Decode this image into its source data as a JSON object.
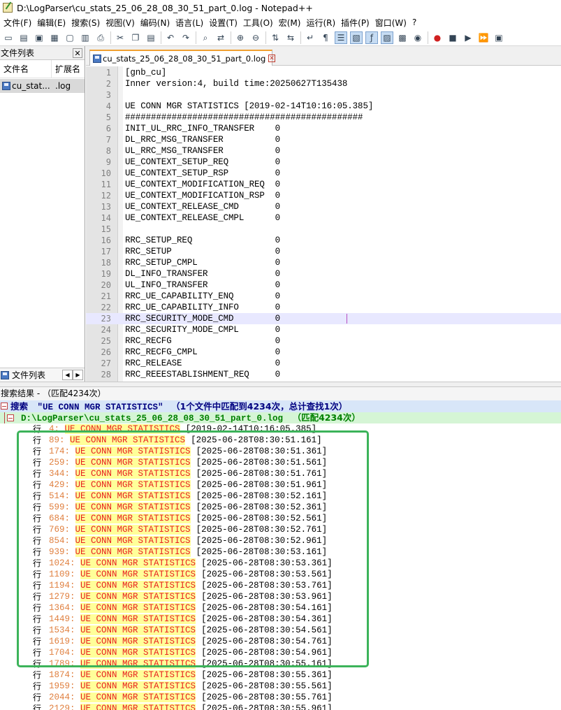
{
  "window": {
    "title": "D:\\LogParser\\cu_stats_25_06_28_08_30_51_part_0.log - Notepad++"
  },
  "menu": [
    "文件(F)",
    "编辑(E)",
    "搜索(S)",
    "视图(V)",
    "编码(N)",
    "语言(L)",
    "设置(T)",
    "工具(O)",
    "宏(M)",
    "运行(R)",
    "插件(P)",
    "窗口(W)",
    "?"
  ],
  "toolbar": {
    "groups": [
      [
        "new-file-icon",
        "open-file-icon",
        "save-icon",
        "save-all-icon",
        "close-icon",
        "close-all-icon",
        "print-icon"
      ],
      [
        "cut-icon",
        "copy-icon",
        "paste-icon"
      ],
      [
        "undo-icon",
        "redo-icon"
      ],
      [
        "find-icon",
        "replace-icon"
      ],
      [
        "zoom-in-icon",
        "zoom-out-icon"
      ],
      [
        "sync-vertical-icon",
        "sync-horizontal-icon"
      ],
      [
        "word-wrap-icon",
        "show-all-chars-icon",
        "indent-guide-icon",
        "doc-map-icon",
        "function-list-icon",
        "folder-workspace-icon",
        "monitoring-icon",
        "eye-icon"
      ],
      [
        "record-macro-icon",
        "stop-macro-icon",
        "play-macro-icon",
        "play-multiple-icon",
        "save-macro-icon"
      ]
    ],
    "glyphs": {
      "new-file-icon": "▭",
      "open-file-icon": "▤",
      "save-icon": "▣",
      "save-all-icon": "▦",
      "close-icon": "▢",
      "close-all-icon": "▥",
      "print-icon": "⎙",
      "cut-icon": "✂",
      "copy-icon": "❐",
      "paste-icon": "▤",
      "undo-icon": "↶",
      "redo-icon": "↷",
      "find-icon": "⌕",
      "replace-icon": "⇄",
      "zoom-in-icon": "⊕",
      "zoom-out-icon": "⊖",
      "sync-vertical-icon": "⇅",
      "sync-horizontal-icon": "⇆",
      "word-wrap-icon": "↵",
      "show-all-chars-icon": "¶",
      "indent-guide-icon": "☰",
      "doc-map-icon": "▧",
      "function-list-icon": "ƒ",
      "folder-workspace-icon": "▨",
      "monitoring-icon": "▩",
      "eye-icon": "◉",
      "record-macro-icon": "●",
      "stop-macro-icon": "■",
      "play-macro-icon": "▶",
      "play-multiple-icon": "⏩",
      "save-macro-icon": "▣"
    },
    "active": [
      "indent-guide-icon",
      "function-list-icon",
      "doc-map-icon",
      "folder-workspace-icon"
    ],
    "accent_record": "#d02020"
  },
  "file_panel": {
    "title": "文件列表",
    "col_name": "文件名",
    "col_ext": "扩展名",
    "files": [
      {
        "name": "cu_stat...",
        "ext": ".log"
      }
    ],
    "tab_label": "文件列表"
  },
  "editor": {
    "tab_label": "cu_stats_25_06_28_08_30_51_part_0.log",
    "current_line": 23,
    "lines": [
      {
        "n": "1",
        "text": "[gnb_cu]"
      },
      {
        "n": "2",
        "text": "Inner version:4, build time:20250627T135438"
      },
      {
        "n": "3",
        "text": ""
      },
      {
        "n": "4",
        "text": "UE CONN MGR STATISTICS [2019-02-14T10:16:05.385]"
      },
      {
        "n": "5",
        "text": "##############################################"
      },
      {
        "n": "6",
        "text": "INIT_UL_RRC_INFO_TRANSFER    0"
      },
      {
        "n": "7",
        "text": "DL_RRC_MSG_TRANSFER          0"
      },
      {
        "n": "8",
        "text": "UL_RRC_MSG_TRANSFER          0"
      },
      {
        "n": "9",
        "text": "UE_CONTEXT_SETUP_REQ         0"
      },
      {
        "n": "10",
        "text": "UE_CONTEXT_SETUP_RSP         0"
      },
      {
        "n": "11",
        "text": "UE_CONTEXT_MODIFICATION_REQ  0"
      },
      {
        "n": "12",
        "text": "UE_CONTEXT_MODIFICATION_RSP  0"
      },
      {
        "n": "13",
        "text": "UE_CONTEXT_RELEASE_CMD       0"
      },
      {
        "n": "14",
        "text": "UE_CONTEXT_RELEASE_CMPL      0"
      },
      {
        "n": "15",
        "text": ""
      },
      {
        "n": "16",
        "text": "RRC_SETUP_REQ                0"
      },
      {
        "n": "17",
        "text": "RRC_SETUP                    0"
      },
      {
        "n": "18",
        "text": "RRC_SETUP_CMPL               0"
      },
      {
        "n": "19",
        "text": "DL_INFO_TRANSFER             0"
      },
      {
        "n": "20",
        "text": "UL_INFO_TRANSFER             0"
      },
      {
        "n": "21",
        "text": "RRC_UE_CAPABILITY_ENQ        0"
      },
      {
        "n": "22",
        "text": "RRC_UE_CAPABILITY_INFO       0"
      },
      {
        "n": "23",
        "text": "RRC_SECURITY_MODE_CMD        0"
      },
      {
        "n": "24",
        "text": "RRC_SECURITY_MODE_CMPL       0"
      },
      {
        "n": "25",
        "text": "RRC_RECFG                    0"
      },
      {
        "n": "26",
        "text": "RRC_RECFG_CMPL               0"
      },
      {
        "n": "27",
        "text": "RRC_RELEASE                  0"
      },
      {
        "n": "28",
        "text": "RRC_REEESTABLISHMENT_REQ     0"
      }
    ]
  },
  "search_results": {
    "header": "搜索结果 - （匹配4234次）",
    "search_label": "搜索",
    "search_query": "\"UE CONN MGR STATISTICS\"",
    "search_summary": "（1个文件中匹配到4234次，总计查找1次）",
    "file_path": "D:\\LogParser\\cu_stats_25_06_28_08_30_51_part_0.log",
    "file_summary": "（匹配4234次）",
    "line_prefix": "行",
    "match_text": "UE CONN MGR STATISTICS",
    "rows": [
      {
        "line": "4",
        "ts": "[2019-02-14T10:16:05.385]"
      },
      {
        "line": "89",
        "ts": "[2025-06-28T08:30:51.161]"
      },
      {
        "line": "174",
        "ts": "[2025-06-28T08:30:51.361]"
      },
      {
        "line": "259",
        "ts": "[2025-06-28T08:30:51.561]"
      },
      {
        "line": "344",
        "ts": "[2025-06-28T08:30:51.761]"
      },
      {
        "line": "429",
        "ts": "[2025-06-28T08:30:51.961]"
      },
      {
        "line": "514",
        "ts": "[2025-06-28T08:30:52.161]"
      },
      {
        "line": "599",
        "ts": "[2025-06-28T08:30:52.361]"
      },
      {
        "line": "684",
        "ts": "[2025-06-28T08:30:52.561]"
      },
      {
        "line": "769",
        "ts": "[2025-06-28T08:30:52.761]"
      },
      {
        "line": "854",
        "ts": "[2025-06-28T08:30:52.961]"
      },
      {
        "line": "939",
        "ts": "[2025-06-28T08:30:53.161]"
      },
      {
        "line": "1024",
        "ts": "[2025-06-28T08:30:53.361]"
      },
      {
        "line": "1109",
        "ts": "[2025-06-28T08:30:53.561]"
      },
      {
        "line": "1194",
        "ts": "[2025-06-28T08:30:53.761]"
      },
      {
        "line": "1279",
        "ts": "[2025-06-28T08:30:53.961]"
      },
      {
        "line": "1364",
        "ts": "[2025-06-28T08:30:54.161]"
      },
      {
        "line": "1449",
        "ts": "[2025-06-28T08:30:54.361]"
      },
      {
        "line": "1534",
        "ts": "[2025-06-28T08:30:54.561]"
      },
      {
        "line": "1619",
        "ts": "[2025-06-28T08:30:54.761]"
      },
      {
        "line": "1704",
        "ts": "[2025-06-28T08:30:54.961]"
      },
      {
        "line": "1789",
        "ts": "[2025-06-28T08:30:55.161]"
      },
      {
        "line": "1874",
        "ts": "[2025-06-28T08:30:55.361]"
      },
      {
        "line": "1959",
        "ts": "[2025-06-28T08:30:55.561]"
      },
      {
        "line": "2044",
        "ts": "[2025-06-28T08:30:55.761]"
      },
      {
        "line": "2129",
        "ts": "[2025-06-28T08:30:55.961]"
      }
    ],
    "highlight_box_color": "#3cb35a"
  }
}
